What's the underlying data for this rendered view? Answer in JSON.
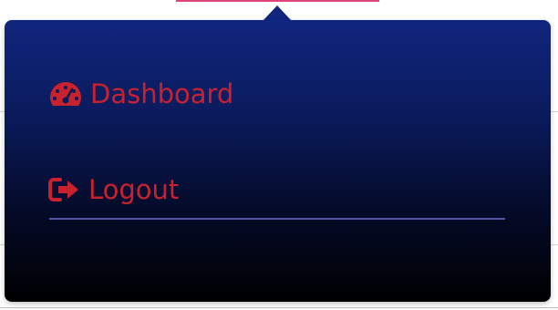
{
  "menu": {
    "items": [
      {
        "label": "Dashboard",
        "icon": "speedometer-icon"
      },
      {
        "label": "Logout",
        "icon": "sign-out-icon"
      }
    ]
  },
  "colors": {
    "accent": "#c8222f",
    "panel_top": "#10267f",
    "panel_bottom": "#000000",
    "divider": "#4f54a6",
    "tab_indicator": "#e0457a"
  }
}
